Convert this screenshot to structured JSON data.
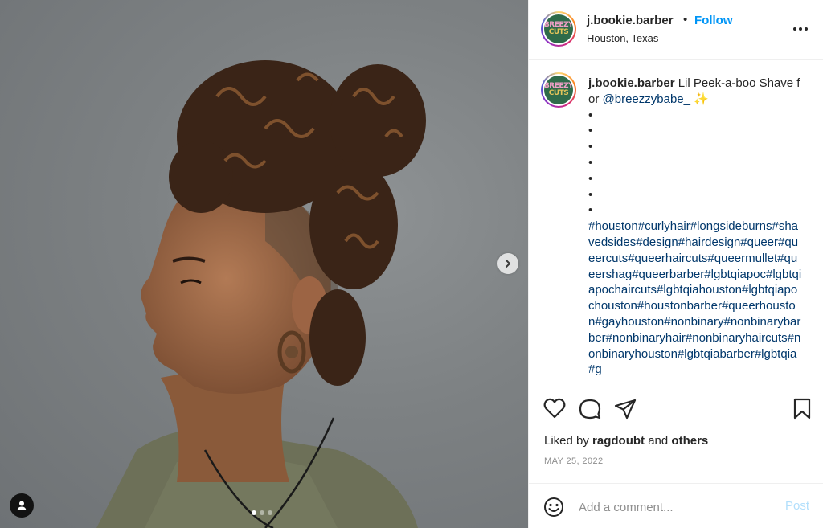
{
  "post": {
    "username": "j.bookie.barber",
    "header_separator": "•",
    "follow_label": "Follow",
    "location": "Houston, Texas",
    "more_icon": "more-horizontal-icon",
    "avatar_logo_lines": [
      "BREEZY",
      "CUTS"
    ],
    "caption": {
      "username": "j.bookie.barber",
      "text_before_mention": "Lil Peek-a-boo Shave for ",
      "mention": "@breezzybabe_",
      "sparkle": "✨",
      "dot_lines": [
        "•",
        "•",
        "•",
        "•",
        "•",
        "•",
        "•"
      ],
      "hashtags": "#houston#curlyhair#longsideburns#shavedsides#design#hairdesign#queer#queercuts#queerhaircuts#queermullet#queershag#queerbarber#lgbtqiapoc#lgbtqiapochaircuts#lgbtqiahouston#lgbtqiapochouston#houstonbarber#queerhouston#gayhouston#nonbinary#nonbinarybarber#nonbinaryhair#nonbinaryhaircuts#nonbinaryhouston#lgbtqiabarber#lgbtqia#g"
    },
    "actions": {
      "like_icon": "heart-icon",
      "comment_icon": "comment-icon",
      "share_icon": "share-icon",
      "save_icon": "bookmark-icon"
    },
    "likes": {
      "prefix": "Liked by",
      "user": "ragdoubt",
      "conjunction": "and",
      "others": "others"
    },
    "date": "MAY 25, 2022",
    "comment": {
      "placeholder": "Add a comment...",
      "post_label": "Post",
      "emoji_icon": "emoji-icon"
    },
    "media": {
      "carousel_total": 3,
      "carousel_active": 1,
      "next_icon": "chevron-right-icon",
      "tag_icon": "user-tag-icon"
    }
  },
  "colors": {
    "follow": "#0095f6",
    "link": "#00376b",
    "muted": "#8e8e8e",
    "post_disabled": "#b2dffc"
  }
}
